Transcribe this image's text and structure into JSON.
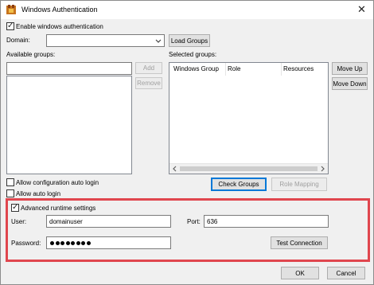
{
  "window": {
    "title": "Windows Authentication"
  },
  "enable_windows_auth": {
    "label": "Enable windows authentication",
    "checked": true
  },
  "domain": {
    "label": "Domain:",
    "value": ""
  },
  "load_groups_label": "Load Groups",
  "available_groups": {
    "label": "Available groups:",
    "filter_value": ""
  },
  "add_label": "Add",
  "remove_label": "Remove",
  "selected_groups": {
    "label": "Selected groups:",
    "columns": [
      "Windows Group",
      "Role",
      "Resources"
    ]
  },
  "move_up_label": "Move Up",
  "move_down_label": "Move Down",
  "check_groups_label": "Check Groups",
  "role_mapping_label": "Role Mapping",
  "allow_config_auto_login": {
    "label": "Allow configuration auto login",
    "checked": false
  },
  "allow_auto_login": {
    "label": "Allow auto login",
    "checked": false
  },
  "advanced": {
    "label": "Advanced runtime settings",
    "checked": true
  },
  "user": {
    "label": "User:",
    "value": "domainuser"
  },
  "port": {
    "label": "Port:",
    "value": "636"
  },
  "password": {
    "label": "Password:",
    "masked_length": 8
  },
  "test_connection_label": "Test Connection",
  "ok_label": "OK",
  "cancel_label": "Cancel",
  "colors": {
    "highlight": "#e0464e",
    "focus": "#0078d7"
  },
  "icons": [
    "app-icon",
    "close-icon",
    "chevron-down-icon",
    "scroll-left-icon",
    "scroll-right-icon",
    "checkbox-check-icon"
  ]
}
